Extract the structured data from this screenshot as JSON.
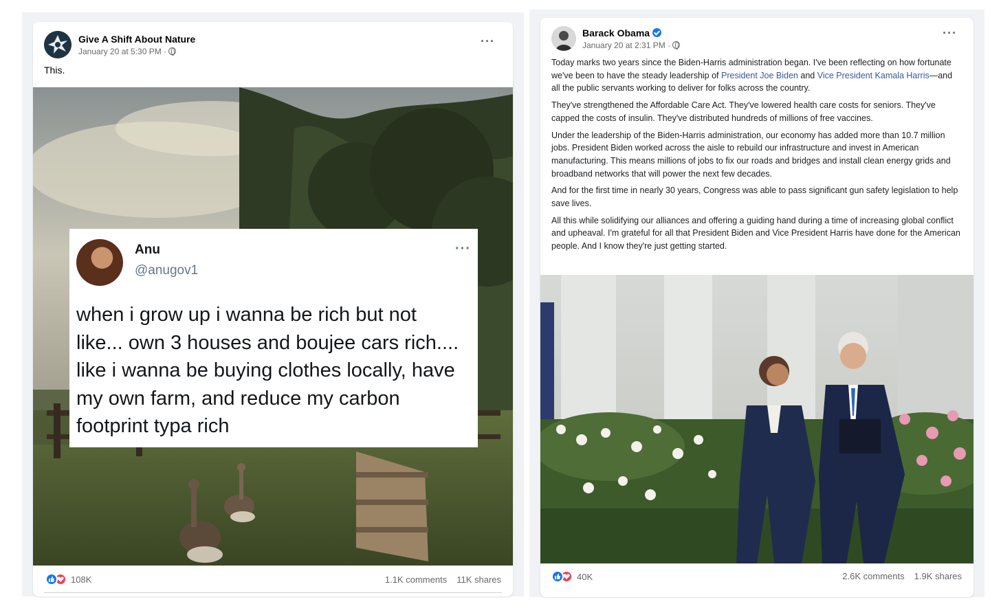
{
  "left_post": {
    "author": "Give A Shift About Nature",
    "timestamp": "January 20 at 5:30 PM · ",
    "caption": "This.",
    "more_label": "···",
    "embedded_tweet": {
      "name": "Anu",
      "handle": "@anugov1",
      "more_label": "···",
      "text": "when i grow up i wanna be rich but not like... own 3 houses and boujee cars rich.... like i wanna be buying clothes locally, have my own farm, and reduce my carbon footprint typa rich"
    },
    "reaction_count": "108K",
    "comments": "1.1K comments",
    "shares": "11K shares"
  },
  "right_post": {
    "author": "Barack Obama",
    "verified": true,
    "timestamp": "January 20 at 2:31 PM · ",
    "more_label": "···",
    "paragraphs": {
      "p1_a": "Today marks two years since the Biden-Harris administration began. I've been reflecting on how fortunate we've been to have the steady leadership of ",
      "p1_link1": "President Joe Biden",
      "p1_b": " and ",
      "p1_link2": "Vice President Kamala Harris",
      "p1_c": "—and all the public servants working to deliver for folks across the country.",
      "p2": "They've strengthened the Affordable Care Act. They've lowered health care costs for seniors. They've capped the costs of insulin. They've distributed hundreds of millions of free vaccines.",
      "p3": "Under the leadership of the Biden-Harris administration, our economy has added more than 10.7 million jobs. President Biden worked across the aisle to rebuild our infrastructure and invest in American manufacturing. This means millions of jobs to fix our roads and bridges and install clean energy grids and broadband networks that will power the next few decades.",
      "p4": "And for the first time in nearly 30 years, Congress was able to pass significant gun safety legislation to help save lives.",
      "p5": "All this while solidifying our alliances and offering a guiding hand during a time of increasing global conflict and upheaval. I'm grateful for all that President Biden and Vice President Harris have done for the American people. And I know they're just getting started."
    },
    "reaction_count": "40K",
    "comments": "2.6K comments",
    "shares": "1.9K shares"
  },
  "colors": {
    "link": "#385898",
    "like": "#1877f2",
    "love": "#f33e58",
    "meta_gray": "#65676b",
    "feed_bg": "#f0f2f5"
  },
  "icons": [
    "page-logo-icon",
    "globe-icon",
    "verified-badge-icon",
    "like-reaction-icon",
    "love-reaction-icon",
    "more-options-icon"
  ]
}
